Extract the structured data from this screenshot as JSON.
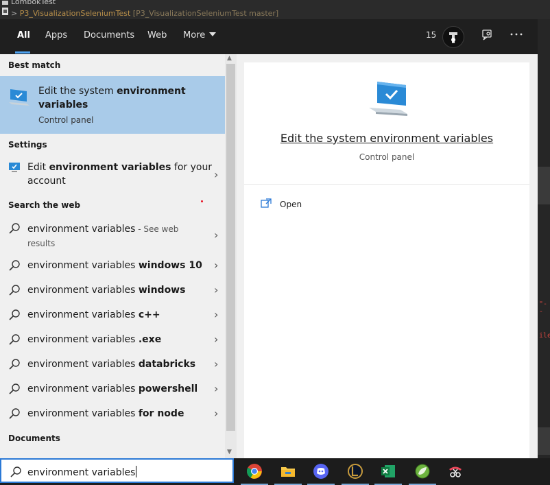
{
  "ide": {
    "title": "LombokTest",
    "path_prefix": ">",
    "path_module": "P3_VisualizationSeleniumTest",
    "path_branch": "[P3_VisualizationSeleniumTest master]",
    "code_fragment_1": "\"--",
    "code_fragment_2": "ile"
  },
  "tabs": {
    "all": "All",
    "apps": "Apps",
    "documents": "Documents",
    "web": "Web",
    "more": "More"
  },
  "top_right": {
    "points": "15"
  },
  "best_match": {
    "header": "Best match",
    "title_plain": "Edit the system ",
    "title_bold": "environment variables",
    "subtitle": "Control panel"
  },
  "settings": {
    "header": "Settings",
    "item_plain_1": "Edit ",
    "item_bold": "environment variables",
    "item_plain_2": " for your",
    "item_line2": "account"
  },
  "web": {
    "header": "Search the web",
    "first": {
      "text": "environment variables",
      "suffix": " - See web",
      "suffix2": "results"
    },
    "items": [
      {
        "plain": "environment variables ",
        "bold": "windows 10"
      },
      {
        "plain": "environment variables ",
        "bold": "windows"
      },
      {
        "plain": "environment variables ",
        "bold": "c++"
      },
      {
        "plain": "environment variables ",
        "bold": ".exe"
      },
      {
        "plain": "environment variables ",
        "bold": "databricks"
      },
      {
        "plain": "environment variables ",
        "bold": "powershell"
      },
      {
        "plain": "environment variables ",
        "bold": "for node"
      }
    ]
  },
  "documents": {
    "header": "Documents"
  },
  "preview": {
    "title": "Edit the system environment variables",
    "subtitle": "Control panel",
    "action_open": "Open"
  },
  "search": {
    "value": "environment variables"
  },
  "taskbar": {
    "apps": [
      "chrome-icon",
      "file-explorer-icon",
      "discord-icon",
      "league-of-legends-icon",
      "excel-icon",
      "spring-tool-suite-icon",
      "snipping-tool-icon"
    ]
  },
  "colors": {
    "accent": "#4ea3f2",
    "selection": "#a9cbe9",
    "panel": "#f0f0f0",
    "topbar": "#1f1f1f"
  }
}
